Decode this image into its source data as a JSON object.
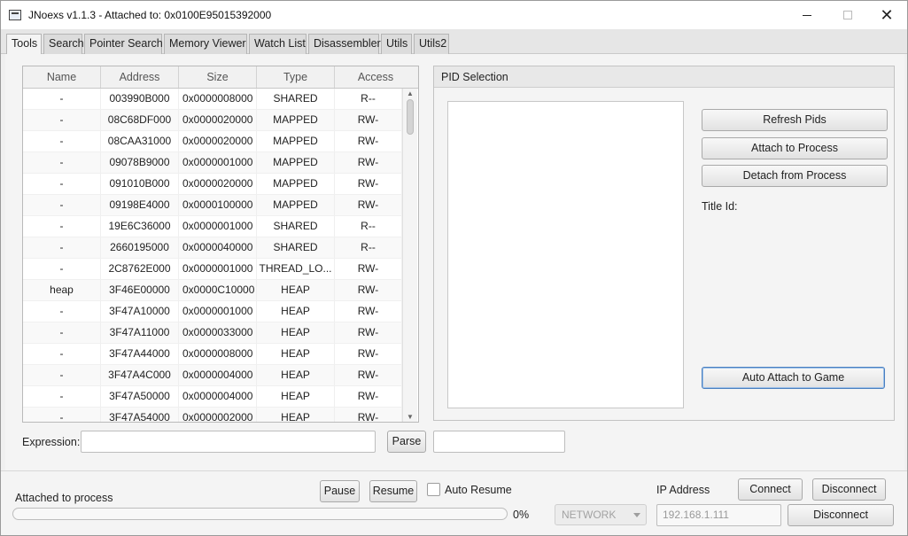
{
  "window": {
    "title": "JNoexs v1.1.3 - Attached to: 0x0100E95015392000",
    "minimize_icon": "minimize-icon",
    "maximize_icon": "maximize-icon",
    "close_glyph": "✕"
  },
  "tabs": [
    {
      "label": "Tools",
      "active": true
    },
    {
      "label": "Search"
    },
    {
      "label": "Pointer Search"
    },
    {
      "label": "Memory Viewer"
    },
    {
      "label": "Watch List"
    },
    {
      "label": "Disassembler"
    },
    {
      "label": "Utils"
    },
    {
      "label": "Utils2"
    }
  ],
  "memory_table": {
    "columns": [
      "Name",
      "Address",
      "Size",
      "Type",
      "Access"
    ],
    "rows": [
      [
        "-",
        "003990B000",
        "0x0000008000",
        "SHARED",
        "R--"
      ],
      [
        "-",
        "08C68DF000",
        "0x0000020000",
        "MAPPED",
        "RW-"
      ],
      [
        "-",
        "08CAA31000",
        "0x0000020000",
        "MAPPED",
        "RW-"
      ],
      [
        "-",
        "09078B9000",
        "0x0000001000",
        "MAPPED",
        "RW-"
      ],
      [
        "-",
        "091010B000",
        "0x0000020000",
        "MAPPED",
        "RW-"
      ],
      [
        "-",
        "09198E4000",
        "0x0000100000",
        "MAPPED",
        "RW-"
      ],
      [
        "-",
        "19E6C36000",
        "0x0000001000",
        "SHARED",
        "R--"
      ],
      [
        "-",
        "2660195000",
        "0x0000040000",
        "SHARED",
        "R--"
      ],
      [
        "-",
        "2C8762E000",
        "0x0000001000",
        "THREAD_LO...",
        "RW-"
      ],
      [
        "heap",
        "3F46E00000",
        "0x0000C10000",
        "HEAP",
        "RW-"
      ],
      [
        "-",
        "3F47A10000",
        "0x0000001000",
        "HEAP",
        "RW-"
      ],
      [
        "-",
        "3F47A11000",
        "0x0000033000",
        "HEAP",
        "RW-"
      ],
      [
        "-",
        "3F47A44000",
        "0x0000008000",
        "HEAP",
        "RW-"
      ],
      [
        "-",
        "3F47A4C000",
        "0x0000004000",
        "HEAP",
        "RW-"
      ],
      [
        "-",
        "3F47A50000",
        "0x0000004000",
        "HEAP",
        "RW-"
      ],
      [
        "-",
        "3F47A54000",
        "0x0000002000",
        "HEAP",
        "RW-"
      ]
    ],
    "scroll_up_glyph": "▲",
    "scroll_down_glyph": "▼"
  },
  "pid_selection": {
    "header": "PID Selection",
    "refresh_label": "Refresh Pids",
    "attach_label": "Attach to Process",
    "detach_label": "Detach from Process",
    "title_id_label": "Title Id:",
    "auto_attach_label": "Auto Attach to Game"
  },
  "expression": {
    "label": "Expression:",
    "value": "",
    "parse_label": "Parse",
    "result": ""
  },
  "status": {
    "message": "Attached to process",
    "progress": 0,
    "progress_text": "0%",
    "pause_label": "Pause",
    "resume_label": "Resume",
    "auto_resume_label": "Auto Resume",
    "auto_resume_checked": false
  },
  "connection": {
    "ip_label": "IP Address",
    "connect_label": "Connect",
    "disconnect_label": "Disconnect",
    "mode_value": "NETWORK",
    "ip_value": "192.168.1.111",
    "disconnect2_label": "Disconnect"
  },
  "colors": {
    "accent": "#4a90d9",
    "focus_border": "#4a7fc0"
  }
}
